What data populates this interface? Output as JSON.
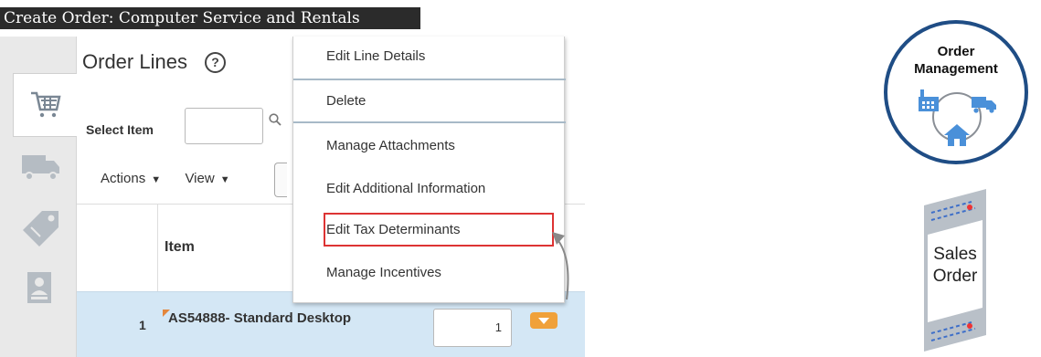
{
  "window": {
    "title": "Create Order: Computer Service and Rentals"
  },
  "order_lines": {
    "title": "Order Lines",
    "help_glyph": "?",
    "select_item_label": "Select Item",
    "toolbar": {
      "actions": "Actions",
      "view": "View"
    },
    "columns": [
      {
        "label": "Item"
      }
    ],
    "rows": [
      {
        "number": "1",
        "item": "AS54888- Standard Desktop",
        "quantity": "1"
      }
    ]
  },
  "dropdown_menu": {
    "items": [
      {
        "label": "Edit Line Details"
      },
      {
        "label": "Delete"
      },
      {
        "label": "Manage Attachments"
      },
      {
        "label": "Edit Additional Information"
      },
      {
        "label": "Edit Tax Determinants",
        "highlighted": true
      },
      {
        "label": "Manage Incentives"
      }
    ]
  },
  "badges": {
    "order_management": {
      "line1": "Order",
      "line2": "Management"
    },
    "sales_order": {
      "line1": "Sales",
      "line2": "Order"
    }
  },
  "colors": {
    "row_selected": "#d4e7f5",
    "menu_button": "#f0a13a",
    "highlight_border": "#dd3333",
    "logo_ring": "#1f4d85",
    "icon_blue": "#4a90d9"
  },
  "icons": [
    "cart-icon",
    "truck-icon",
    "tag-icon",
    "contact-card-icon",
    "help-icon",
    "search-icon",
    "caret-down-icon"
  ]
}
